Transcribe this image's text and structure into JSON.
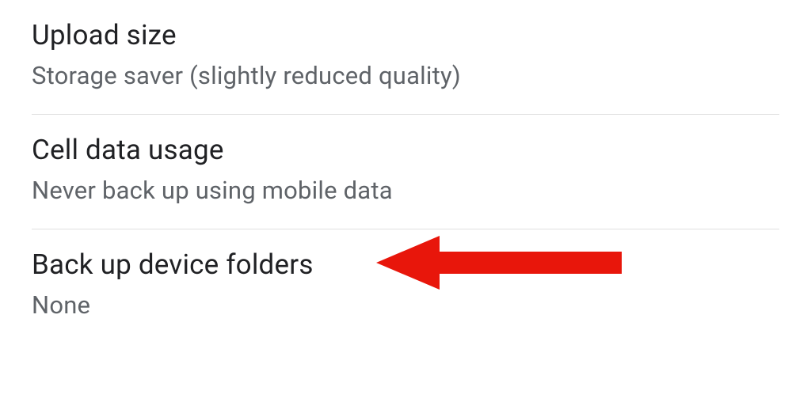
{
  "settings": {
    "items": [
      {
        "title": "Upload size",
        "subtitle": "Storage saver (slightly reduced quality)"
      },
      {
        "title": "Cell data usage",
        "subtitle": "Never back up using mobile data"
      },
      {
        "title": "Back up device folders",
        "subtitle": "None"
      }
    ]
  },
  "annotation": {
    "arrow_color": "#e8160b",
    "target_item_index": 2
  }
}
